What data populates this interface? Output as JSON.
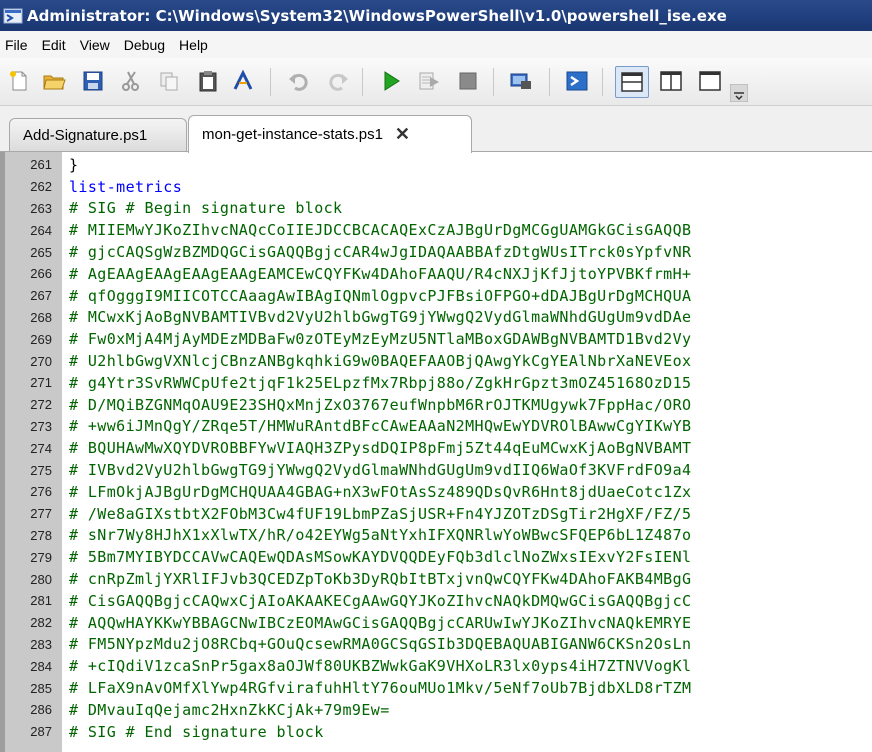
{
  "window": {
    "title": "Administrator: C:\\Windows\\System32\\WindowsPowerShell\\v1.0\\powershell_ise.exe",
    "app_icon": "powershell-ise-icon"
  },
  "menu": [
    "File",
    "Edit",
    "View",
    "Debug",
    "Help"
  ],
  "toolbar": [
    {
      "name": "new-icon"
    },
    {
      "name": "open-icon"
    },
    {
      "name": "save-icon"
    },
    {
      "name": "cut-icon"
    },
    {
      "name": "copy-icon"
    },
    {
      "name": "paste-icon"
    },
    {
      "name": "clear-icon"
    },
    {
      "name": "undo-icon"
    },
    {
      "name": "redo-icon"
    },
    {
      "name": "run-script-icon"
    },
    {
      "name": "run-selection-icon"
    },
    {
      "name": "stop-icon"
    },
    {
      "name": "remote-tab-icon"
    },
    {
      "name": "powershell-console-icon"
    },
    {
      "name": "layout-top-icon"
    },
    {
      "name": "layout-right-icon"
    },
    {
      "name": "layout-max-icon"
    }
  ],
  "tabs": [
    {
      "label": "Add-Signature.ps1",
      "active": false
    },
    {
      "label": "mon-get-instance-stats.ps1",
      "active": true,
      "close": "✕"
    }
  ],
  "colors": {
    "comment": "#006400",
    "command": "#0000ff",
    "plain": "#000000",
    "gutter": "#c9c9c9"
  },
  "editor": {
    "lines": [
      {
        "num": "261",
        "text": "}",
        "kind": "plain"
      },
      {
        "num": "262",
        "text": "list-metrics",
        "kind": "cmd"
      },
      {
        "num": "263",
        "text": "# SIG # Begin signature block",
        "kind": "comment"
      },
      {
        "num": "264",
        "text": "# MIIEMwYJKoZIhvcNAQcCoIIEJDCCBCACAQExCzAJBgUrDgMCGgUAMGkGCisGAQQB",
        "kind": "comment"
      },
      {
        "num": "265",
        "text": "# gjcCAQSgWzBZMDQGCisGAQQBgjcCAR4wJgIDAQAABBAfzDtgWUsITrck0sYpfvNR",
        "kind": "comment"
      },
      {
        "num": "266",
        "text": "# AgEAAgEAAgEAAgEAAgEAMCEwCQYFKw4DAhoFAAQU/R4cNXJjKfJjtoYPVBKfrmH+",
        "kind": "comment"
      },
      {
        "num": "267",
        "text": "# qfOgggI9MIICOTCCAaagAwIBAgIQNmlOgpvcPJFBsiOFPGO+dDAJBgUrDgMCHQUA",
        "kind": "comment"
      },
      {
        "num": "268",
        "text": "# MCwxKjAoBgNVBAMTIVBvd2VyU2hlbGwgTG9jYWwgQ2VydGlmaWNhdGUgUm9vdDAe",
        "kind": "comment"
      },
      {
        "num": "269",
        "text": "# Fw0xMjA4MjAyMDEzMDBaFw0zOTEyMzEyMzU5NTlaMBoxGDAWBgNVBAMTD1Bvd2Vy",
        "kind": "comment"
      },
      {
        "num": "270",
        "text": "# U2hlbGwgVXNlcjCBnzANBgkqhkiG9w0BAQEFAAOBjQAwgYkCgYEAlNbrXaNEVEox",
        "kind": "comment"
      },
      {
        "num": "271",
        "text": "# g4Ytr3SvRWWCpUfe2tjqF1k25ELpzfMx7Rbpj88o/ZgkHrGpzt3mOZ45168OzD15",
        "kind": "comment"
      },
      {
        "num": "272",
        "text": "# D/MQiBZGNMqOAU9E23SHQxMnjZxO3767eufWnpbM6RrOJTKMUgywk7FppHac/ORO",
        "kind": "comment"
      },
      {
        "num": "273",
        "text": "# +ww6iJMnQgY/ZRqe5T/HMWuRAntdBFcCAwEAAaN2MHQwEwYDVROlBAwwCgYIKwYB",
        "kind": "comment"
      },
      {
        "num": "274",
        "text": "# BQUHAwMwXQYDVROBBFYwVIAQH3ZPysdDQIP8pFmj5Zt44qEuMCwxKjAoBgNVBAMT",
        "kind": "comment"
      },
      {
        "num": "275",
        "text": "# IVBvd2VyU2hlbGwgTG9jYWwgQ2VydGlmaWNhdGUgUm9vdIIQ6WaOf3KVFrdFO9a4",
        "kind": "comment"
      },
      {
        "num": "276",
        "text": "# LFmOkjAJBgUrDgMCHQUAA4GBAG+nX3wFOtAsSz489QDsQvR6Hnt8jdUaeCotc1Zx",
        "kind": "comment"
      },
      {
        "num": "277",
        "text": "# /We8aGIXstbtX2FObM3Cw4fUF19LbmPZaSjUSR+Fn4YJZOTzDSgTir2HgXF/FZ/5",
        "kind": "comment"
      },
      {
        "num": "278",
        "text": "# sNr7Wy8HJhX1xXlwTX/hR/o42EYWg5aNtYxhIFXQNRlwYoWBwcSFQEP6bL1Z487o",
        "kind": "comment"
      },
      {
        "num": "279",
        "text": "# 5Bm7MYIBYDCCAVwCAQEwQDAsMSowKAYDVQQDEyFQb3dlclNoZWxsIExvY2FsIENl",
        "kind": "comment"
      },
      {
        "num": "280",
        "text": "# cnRpZmljYXRlIFJvb3QCEDZpToKb3DyRQbItBTxjvnQwCQYFKw4DAhoFAKB4MBgG",
        "kind": "comment"
      },
      {
        "num": "281",
        "text": "# CisGAQQBgjcCAQwxCjAIoAKAAKECgAAwGQYJKoZIhvcNAQkDMQwGCisGAQQBgjcC",
        "kind": "comment"
      },
      {
        "num": "282",
        "text": "# AQQwHAYKKwYBBAGCNwIBCzEOMAwGCisGAQQBgjcCARUwIwYJKoZIhvcNAQkEMRYE",
        "kind": "comment"
      },
      {
        "num": "283",
        "text": "# FM5NYpzMdu2jO8RCbq+GOuQcsewRMA0GCSqGSIb3DQEBAQUABIGANW6CKSn2OsLn",
        "kind": "comment"
      },
      {
        "num": "284",
        "text": "# +cIQdiV1zcaSnPr5gax8aOJWf80UKBZWwkGaK9VHXoLR3lx0yps4iH7ZTNVVogKl",
        "kind": "comment"
      },
      {
        "num": "285",
        "text": "# LFaX9nAvOMfXlYwp4RGfvirafuhHltY76ouMUo1Mkv/5eNf7oUb7BjdbXLD8rTZM",
        "kind": "comment"
      },
      {
        "num": "286",
        "text": "# DMvauIqQejamc2HxnZkKCjAk+79m9Ew=",
        "kind": "comment"
      },
      {
        "num": "287",
        "text": "# SIG # End signature block",
        "kind": "comment"
      }
    ]
  }
}
